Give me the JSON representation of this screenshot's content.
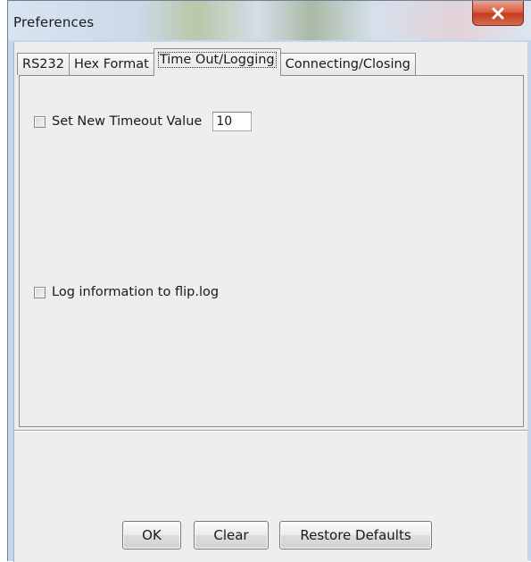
{
  "window": {
    "title": "Preferences"
  },
  "icons": {
    "close": "close-icon"
  },
  "tabs": [
    {
      "label": "RS232",
      "active": false
    },
    {
      "label": "Hex Format",
      "active": false
    },
    {
      "label": "Time Out/Logging",
      "active": true
    },
    {
      "label": "Connecting/Closing",
      "active": false
    }
  ],
  "panel": {
    "timeout": {
      "label": "Set New Timeout Value",
      "checked": false,
      "value": "10"
    },
    "logging": {
      "label": "Log information to flip.log",
      "checked": false
    }
  },
  "buttons": {
    "ok": "OK",
    "clear": "Clear",
    "restore": "Restore Defaults"
  },
  "colors": {
    "close_button": "#c9452a",
    "window_frame": "#c4d7ec",
    "client_background": "#eeeeee"
  }
}
